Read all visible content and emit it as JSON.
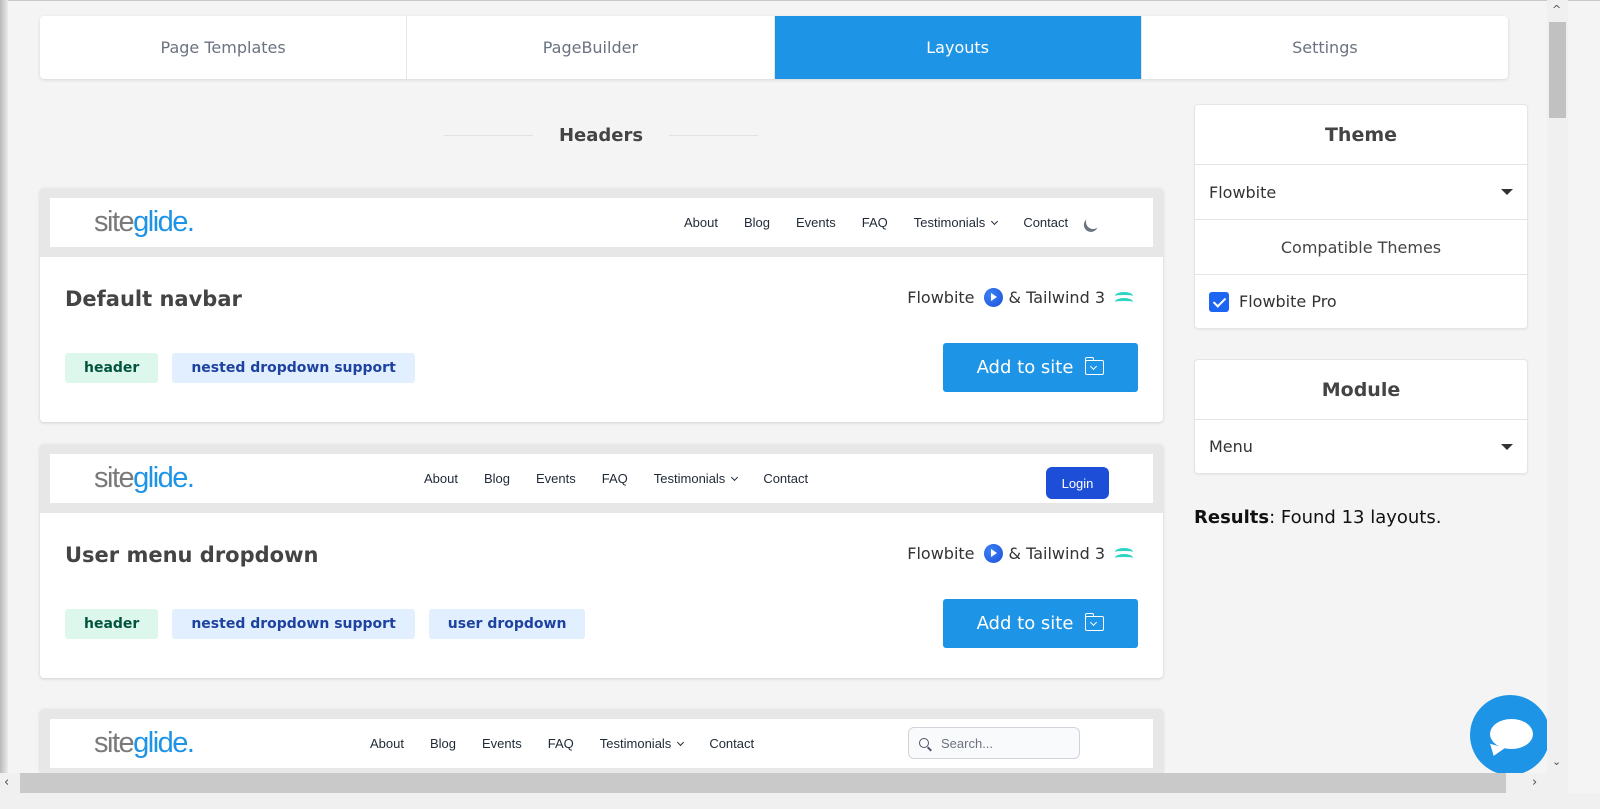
{
  "tabs": [
    {
      "label": "Page Templates",
      "active": false
    },
    {
      "label": "PageBuilder",
      "active": false
    },
    {
      "label": "Layouts",
      "active": true
    },
    {
      "label": "Settings",
      "active": false
    }
  ],
  "section": {
    "title": "Headers"
  },
  "layouts": [
    {
      "title": "Default navbar",
      "preview": {
        "logo_site": "site",
        "logo_glide": "glide.",
        "nav": [
          "About",
          "Blog",
          "Events",
          "FAQ",
          "Testimonials",
          "Contact"
        ],
        "extra": "dark-mode-toggle"
      },
      "compat_theme": "Flowbite",
      "compat_framework": "& Tailwind 3",
      "tags": [
        {
          "label": "header",
          "color": "green"
        },
        {
          "label": "nested dropdown support",
          "color": "blue"
        }
      ],
      "button": "Add to site"
    },
    {
      "title": "User menu dropdown",
      "preview": {
        "logo_site": "site",
        "logo_glide": "glide.",
        "nav": [
          "About",
          "Blog",
          "Events",
          "FAQ",
          "Testimonials",
          "Contact"
        ],
        "extra_label": "Login"
      },
      "compat_theme": "Flowbite",
      "compat_framework": "& Tailwind 3",
      "tags": [
        {
          "label": "header",
          "color": "green"
        },
        {
          "label": "nested dropdown support",
          "color": "blue"
        },
        {
          "label": "user dropdown",
          "color": "blue"
        }
      ],
      "button": "Add to site"
    },
    {
      "preview": {
        "logo_site": "site",
        "logo_glide": "glide.",
        "nav": [
          "About",
          "Blog",
          "Events",
          "FAQ",
          "Testimonials",
          "Contact"
        ],
        "search_placeholder": "Search..."
      }
    }
  ],
  "sidebar": {
    "theme": {
      "heading": "Theme",
      "selected": "Flowbite",
      "compatible_heading": "Compatible Themes",
      "compatible": [
        {
          "label": "Flowbite Pro",
          "checked": true
        }
      ]
    },
    "module": {
      "heading": "Module",
      "selected": "Menu"
    },
    "results_label": "Results",
    "results_text": ": Found 13 layouts."
  },
  "colors": {
    "accent": "#1e94e6",
    "login": "#1d4ed8",
    "tag_green_bg": "#def7ec",
    "tag_blue_bg": "#e1effe"
  }
}
